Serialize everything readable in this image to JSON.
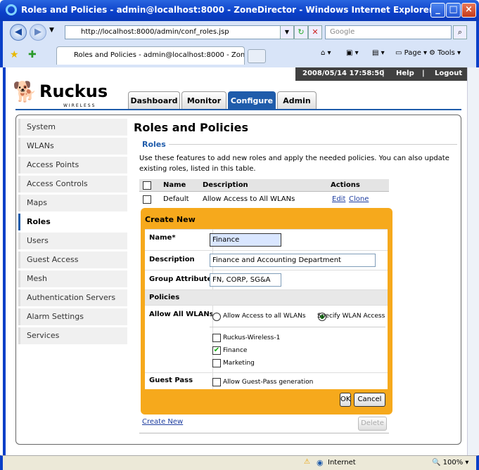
{
  "window": {
    "title": "Roles and Policies - admin@localhost:8000 - ZoneDirector - Windows Internet Explorer"
  },
  "browser": {
    "address": "http://localhost:8000/admin/conf_roles.jsp",
    "search_placeholder": "Google",
    "tab_title": "Roles and Policies - admin@localhost:8000 - ZoneDire...",
    "tools": {
      "page": "Page",
      "tools": "Tools"
    }
  },
  "header": {
    "logo_text": "Ruckus",
    "logo_sub": "WIRELESS",
    "datetime": "2008/05/14 17:58:50",
    "help": "Help",
    "logout": "Logout",
    "tabs": [
      "Dashboard",
      "Monitor",
      "Configure",
      "Admin"
    ]
  },
  "sidebar": {
    "items": [
      "System",
      "WLANs",
      "Access Points",
      "Access Controls",
      "Maps",
      "Roles",
      "Users",
      "Guest Access",
      "Mesh",
      "Authentication Servers",
      "Alarm Settings",
      "Services"
    ]
  },
  "main": {
    "title": "Roles and Policies",
    "section": "Roles",
    "description": "Use these features to add new roles and apply the needed policies. You can also update existing roles, listed in this table.",
    "columns": [
      "Name",
      "Description",
      "Actions"
    ],
    "rows": [
      {
        "name": "Default",
        "description": "Allow Access to All WLANs",
        "edit": "Edit",
        "clone": "Clone"
      }
    ],
    "create_new_link": "Create New",
    "delete_button": "Delete"
  },
  "form": {
    "header": "Create New",
    "name_label": "Name*",
    "name_value": "Finance",
    "description_label": "Description",
    "description_value": "Finance and Accounting Department",
    "group_label": "Group Attributes",
    "group_value": "FN, CORP, SG&A",
    "policies_label": "Policies",
    "allow_label": "Allow All WLANs",
    "radio_all": "Allow Access to all WLANs",
    "radio_specify": "Specify WLAN Access",
    "wlans": [
      {
        "label": "Ruckus-Wireless-1",
        "checked": false
      },
      {
        "label": "Finance",
        "checked": true
      },
      {
        "label": "Marketing",
        "checked": false
      }
    ],
    "guest_label": "Guest Pass",
    "guest_option": "Allow Guest-Pass generation",
    "ok": "OK",
    "cancel": "Cancel"
  },
  "status": {
    "zone": "Internet",
    "zoom": "100%"
  }
}
